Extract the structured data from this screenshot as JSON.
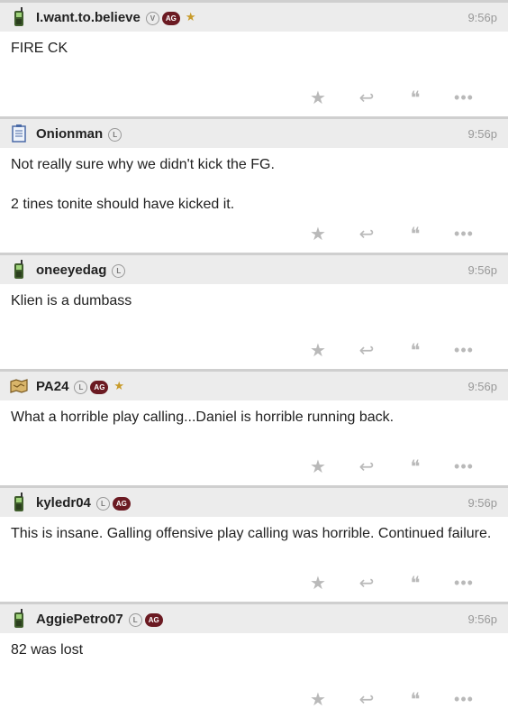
{
  "posts": [
    {
      "username": "I.want.to.believe",
      "avatar_icon": "cellphone-icon",
      "badges": [
        "V",
        "AG",
        "★"
      ],
      "time": "9:56p",
      "lines": [
        "FIRE CK"
      ]
    },
    {
      "username": "Onionman",
      "avatar_icon": "notepad-icon",
      "badges": [
        "L"
      ],
      "time": "9:56p",
      "lines": [
        "Not really sure why we didn't kick the FG.",
        "",
        "2 tines tonite should have kicked it."
      ]
    },
    {
      "username": "oneeyedag",
      "avatar_icon": "cellphone-icon",
      "badges": [
        "L"
      ],
      "time": "9:56p",
      "lines": [
        "Klien is a dumbass"
      ]
    },
    {
      "username": "PA24",
      "avatar_icon": "treasure-map-icon",
      "badges": [
        "L",
        "AG",
        "★"
      ],
      "time": "9:56p",
      "lines": [
        "What a horrible play calling...Daniel is horrible running back."
      ]
    },
    {
      "username": "kyledr04",
      "avatar_icon": "cellphone-icon",
      "badges": [
        "L",
        "AG"
      ],
      "time": "9:56p",
      "lines": [
        "This is insane. Galling offensive play calling was horrible. Continued failure."
      ]
    },
    {
      "username": "AggiePetro07",
      "avatar_icon": "cellphone-icon",
      "badges": [
        "L",
        "AG"
      ],
      "time": "9:56p",
      "lines": [
        "82 was lost"
      ]
    }
  ],
  "actions": [
    {
      "name": "star-icon",
      "glyph": "★"
    },
    {
      "name": "reply-icon",
      "glyph": "↩"
    },
    {
      "name": "quote-icon",
      "glyph": "❝"
    },
    {
      "name": "more-dots-icon",
      "glyph": "•••"
    }
  ],
  "colors": {
    "accent_maroon": "#6b1a22",
    "star_gold": "#c89b2a",
    "header_bg": "#ececec"
  }
}
